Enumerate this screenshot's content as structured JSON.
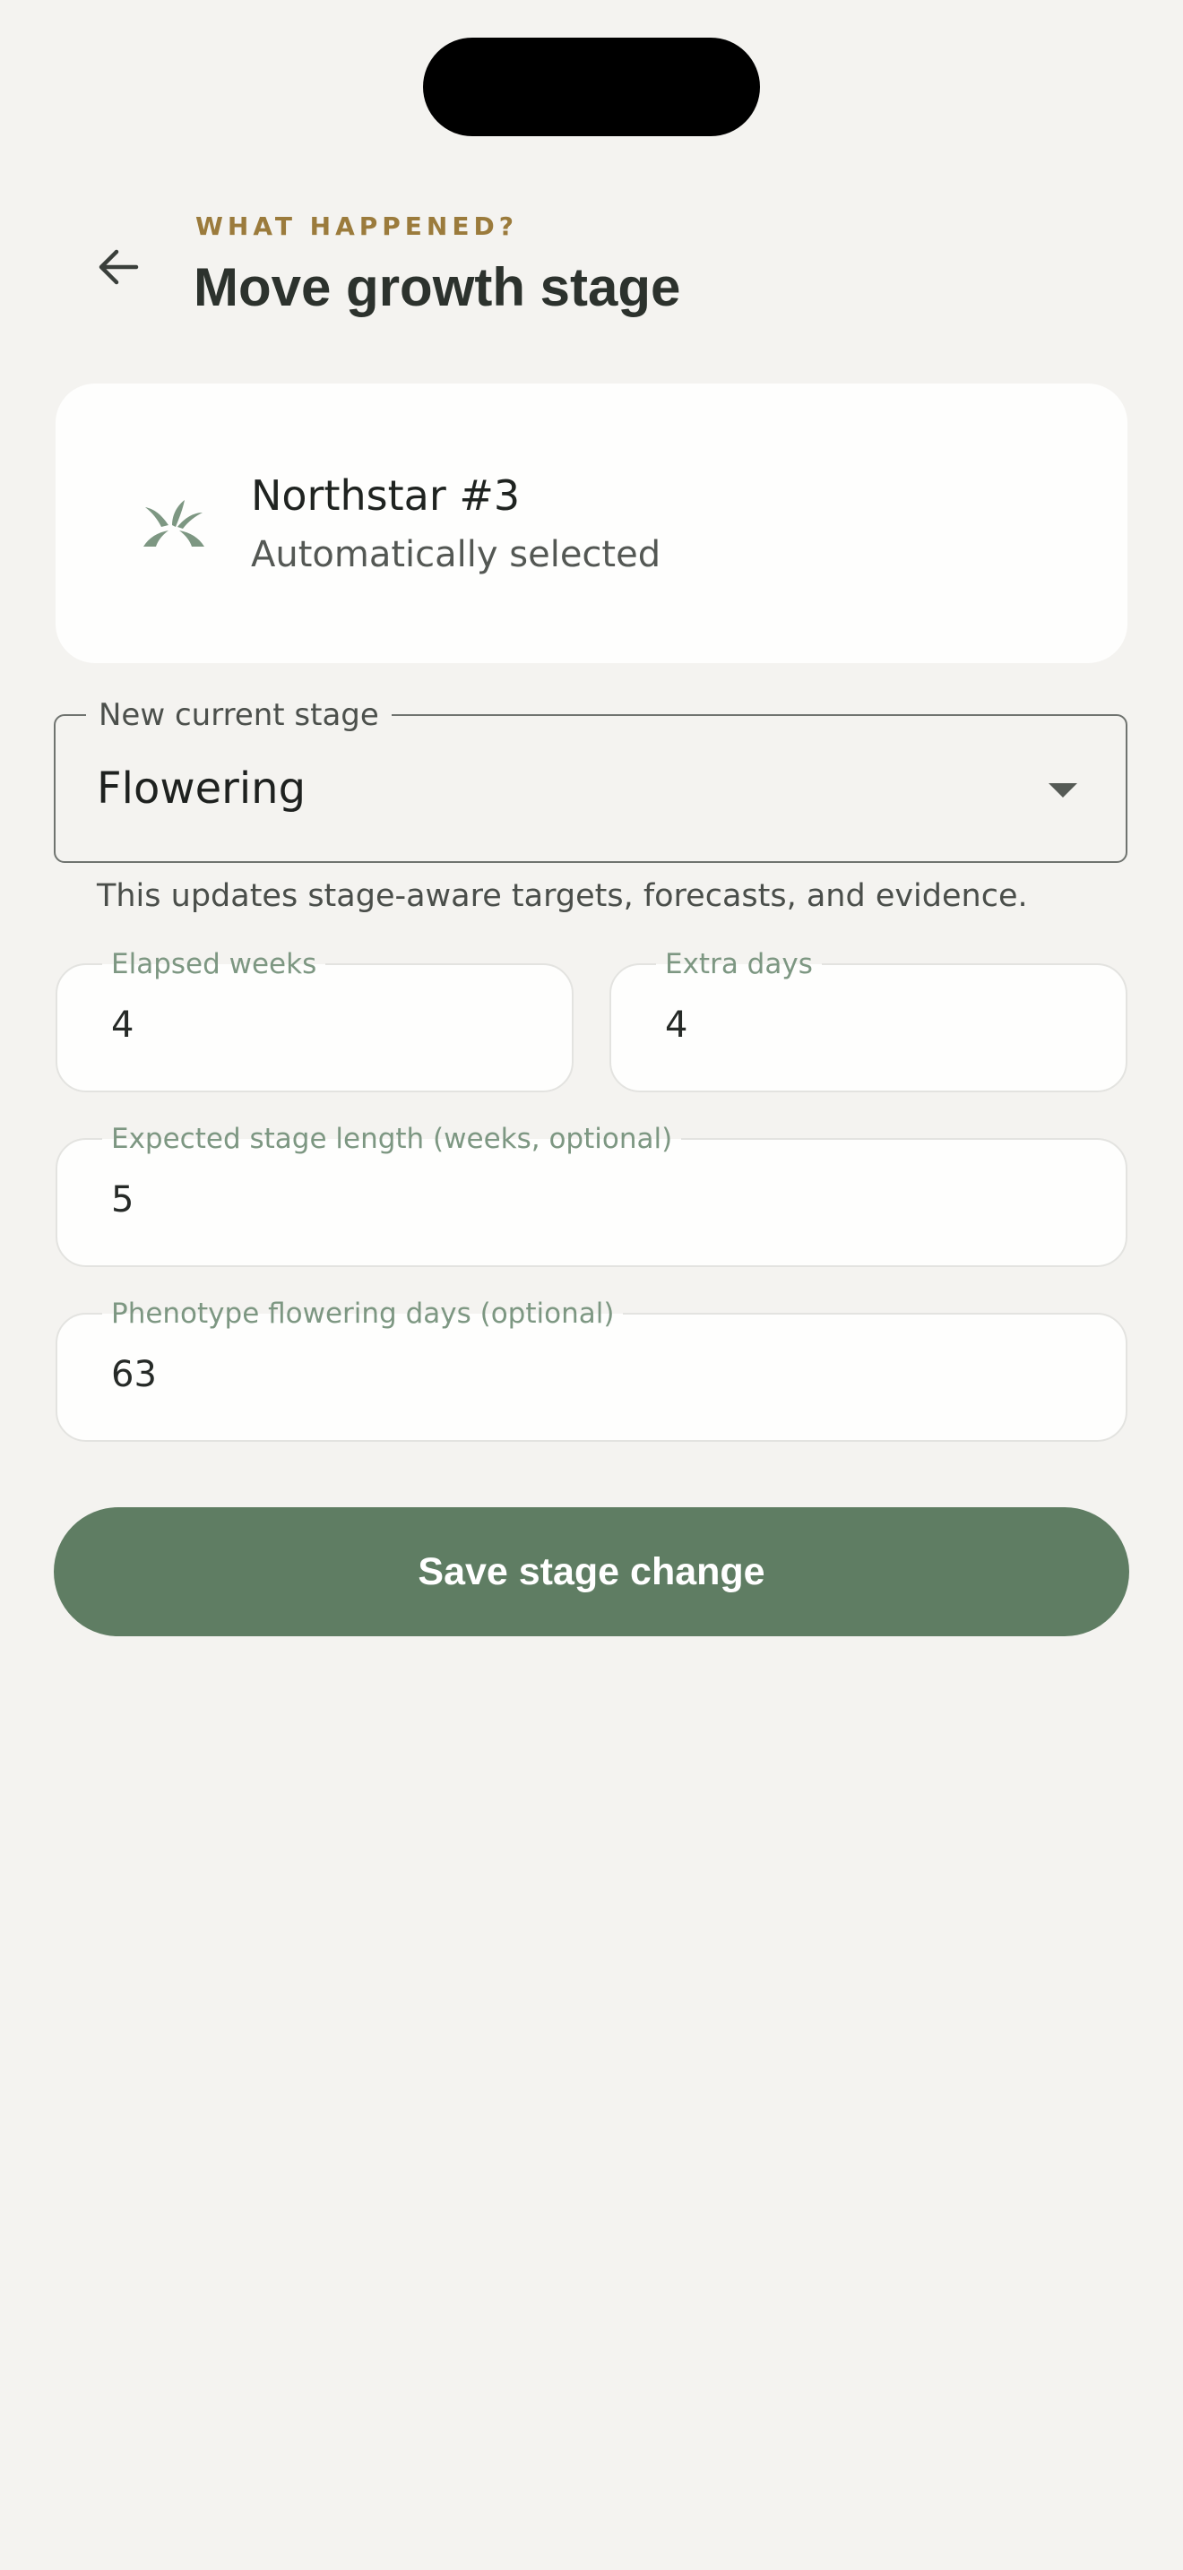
{
  "header": {
    "eyebrow": "WHAT HAPPENED?",
    "title": "Move growth stage",
    "back_icon": "arrow-left-icon"
  },
  "plant": {
    "name": "Northstar #3",
    "subtitle": "Automatically selected",
    "icon": "plant-sprout-icon"
  },
  "stage_select": {
    "label": "New current stage",
    "value": "Flowering",
    "helper": "This updates stage-aware targets, forecasts, and evidence."
  },
  "fields": {
    "elapsed_weeks": {
      "label": "Elapsed weeks",
      "value": "4"
    },
    "extra_days": {
      "label": "Extra days",
      "value": "4"
    },
    "expected_length": {
      "label": "Expected stage length (weeks, optional)",
      "value": "5"
    },
    "phenotype_days": {
      "label": "Phenotype flowering days (optional)",
      "value": "63"
    }
  },
  "actions": {
    "save_label": "Save stage change"
  },
  "colors": {
    "background": "#f4f3f0",
    "accent_green": "#5f7d63",
    "eyebrow_gold": "#9b7b3c",
    "label_green": "#7d9782"
  }
}
